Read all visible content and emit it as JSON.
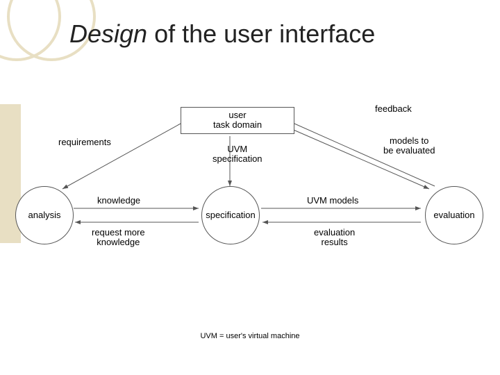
{
  "title_part1": "Design",
  "title_part2": " of the user interface",
  "nodes": {
    "userTaskDomain": "user\ntask domain",
    "analysis": "analysis",
    "specification": "specification",
    "evaluation": "evaluation"
  },
  "edges": {
    "requirements": "requirements",
    "feedback": "feedback",
    "uvmSpec": "UVM\nspecification",
    "modelsToEval": "models to\nbe evaluated",
    "knowledge": "knowledge",
    "requestMore": "request more\nknowledge",
    "uvmModels": "UVM models",
    "evalResults": "evaluation\nresults"
  },
  "footnote": "UVM = user's virtual machine"
}
